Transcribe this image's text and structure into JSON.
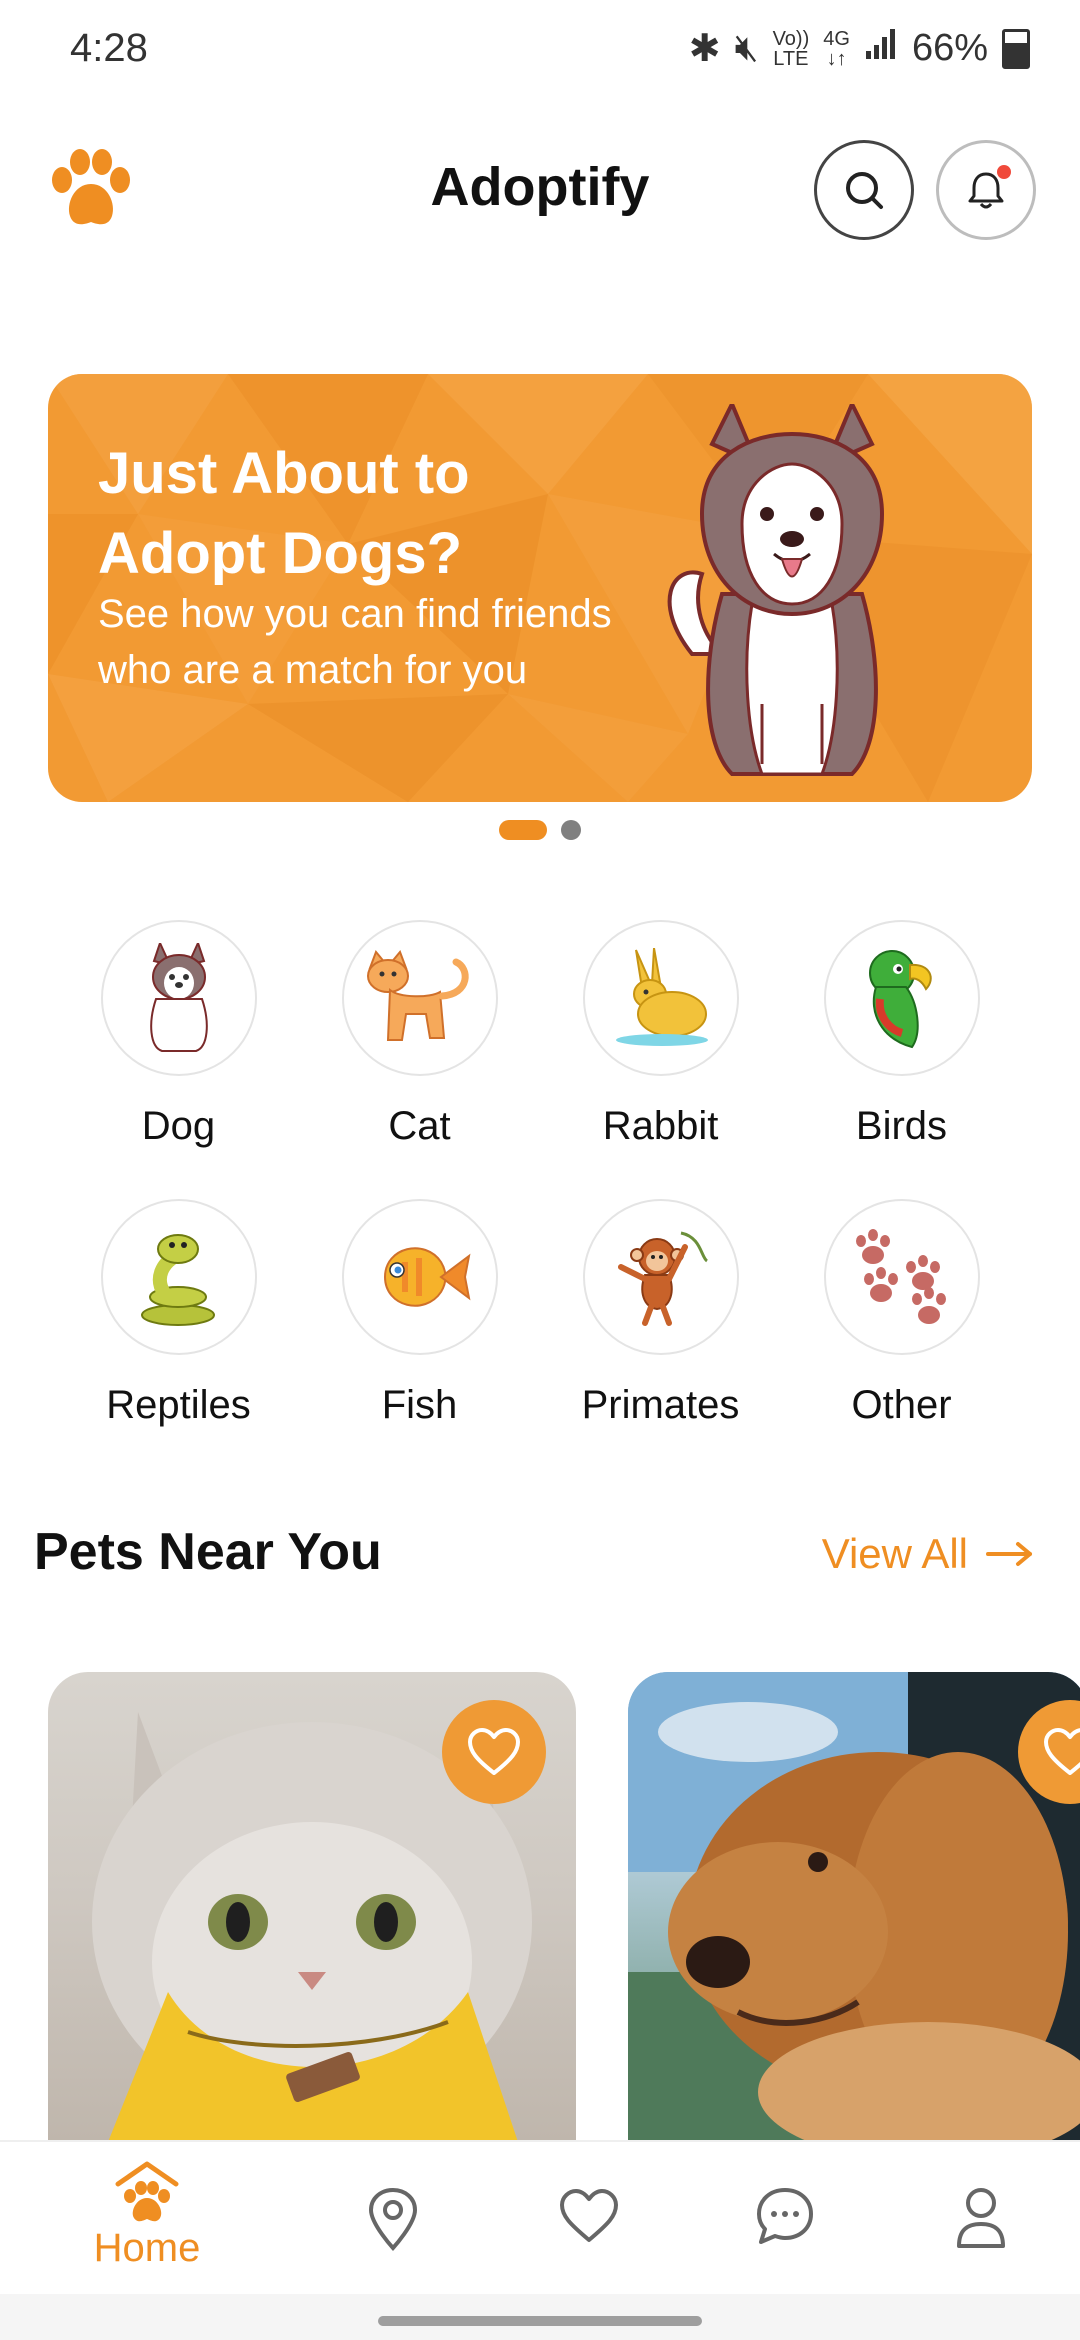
{
  "status": {
    "time": "4:28",
    "battery": "66%",
    "volte_top": "Vo))",
    "volte_bottom": "LTE",
    "net_top": "4G",
    "net_bottom": "↓↑"
  },
  "header": {
    "title": "Adoptify"
  },
  "banner": {
    "title": "Just About to Adopt Dogs?",
    "subtitle": "See how you can find friends who are a match for you"
  },
  "categories": [
    {
      "label": "Dog",
      "icon": "dog-icon"
    },
    {
      "label": "Cat",
      "icon": "cat-icon"
    },
    {
      "label": "Rabbit",
      "icon": "rabbit-icon"
    },
    {
      "label": "Birds",
      "icon": "parrot-icon"
    },
    {
      "label": "Reptiles",
      "icon": "snake-icon"
    },
    {
      "label": "Fish",
      "icon": "fish-icon"
    },
    {
      "label": "Primates",
      "icon": "monkey-icon"
    },
    {
      "label": "Other",
      "icon": "paws-icon"
    }
  ],
  "section": {
    "title": "Pets Near You",
    "view_all": "View All"
  },
  "nav": {
    "home_label": "Home"
  },
  "colors": {
    "accent": "#ef8e22",
    "banner": "#f29a33"
  }
}
